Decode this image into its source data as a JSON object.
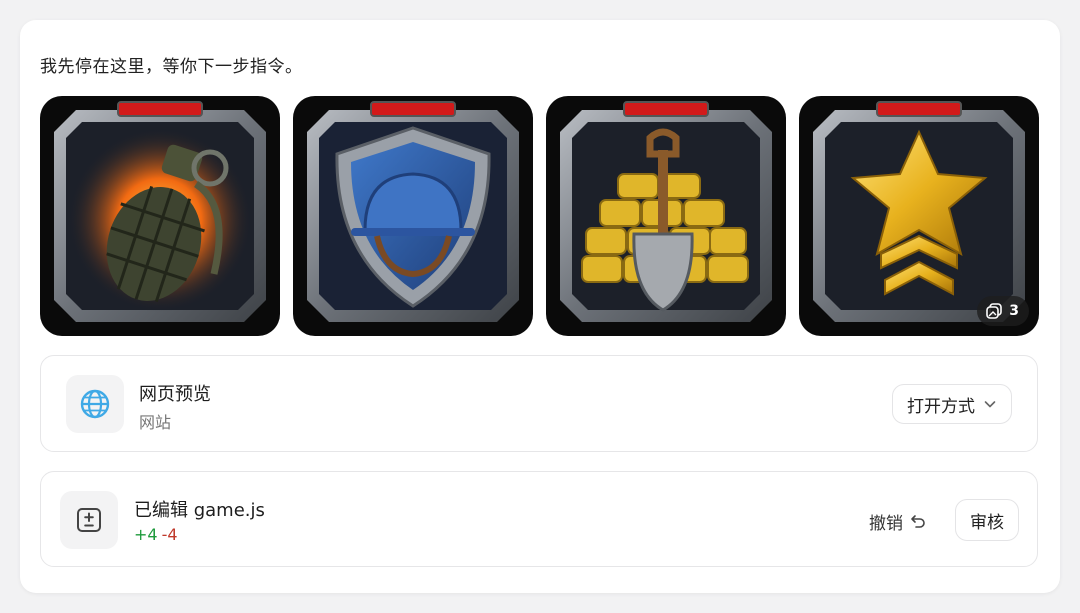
{
  "message": "我先停在这里，等你下一步指令。",
  "gallery": {
    "images": [
      {
        "icon": "grenade-icon"
      },
      {
        "icon": "helmet-shield-icon"
      },
      {
        "icon": "shovel-sandbags-icon"
      },
      {
        "icon": "star-rank-icon"
      }
    ],
    "extra_count": "3",
    "colors": {
      "frame": "#8a8f96",
      "inner": "#1c2029",
      "accent": "#d21a1a"
    }
  },
  "preview": {
    "title": "网页预览",
    "subtitle": "网站",
    "open_with_label": "打开方式",
    "icon": "globe-icon"
  },
  "edit": {
    "title": "已编辑 game.js",
    "additions": "+4",
    "deletions": "-4",
    "undo_label": "撤销",
    "review_label": "审核",
    "icon": "diff-icon"
  }
}
